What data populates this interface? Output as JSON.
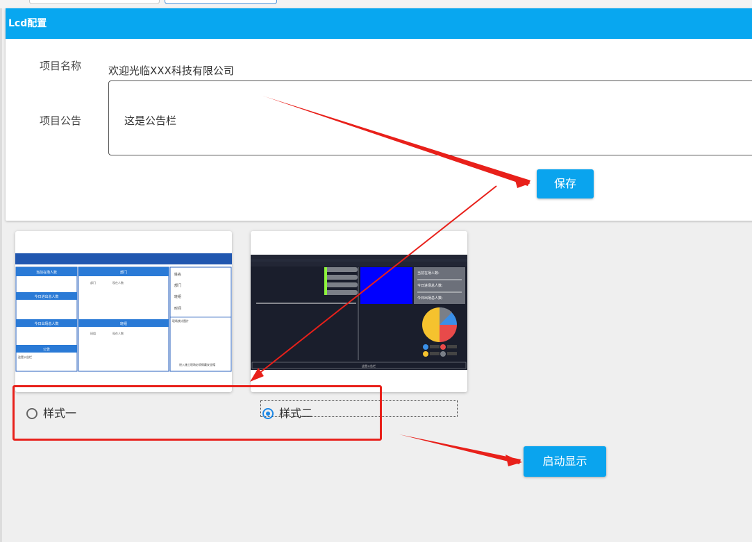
{
  "panel": {
    "title": "Lcd配置",
    "project_name_label": "项目名称",
    "project_name_value": "欢迎光临XXX科技有限公司",
    "notice_label": "项目公告",
    "notice_value": "这是公告栏",
    "save_label": "保存"
  },
  "styles": {
    "option1_label": "样式一",
    "option2_label": "样式二",
    "selected": "样式二",
    "start_label": "启动显示"
  },
  "thumb1": {
    "c1": [
      "当前在场人数",
      "今日进出总人数",
      "今日出场总人数",
      "公告"
    ],
    "notice_text": "这是公告栏",
    "dept_title": "部门",
    "dept_cols": [
      "部门",
      "现在人数"
    ],
    "team_title": "班组",
    "team_cols": [
      "班组",
      "现在人数"
    ],
    "info": [
      "姓名",
      "部门",
      "班组",
      "时间"
    ],
    "stats": "现场统计图片",
    "footer": "进入施工现场必须佩戴安全帽"
  },
  "thumb2": {
    "stats": [
      "当前在场人数:",
      "今日进场总人数:",
      "今日出场总人数:"
    ],
    "footer": "这是公告栏"
  },
  "colors": {
    "accent": "#08a7f0",
    "annotation": "#e8201a",
    "radio_checked": "#1e88e5"
  }
}
